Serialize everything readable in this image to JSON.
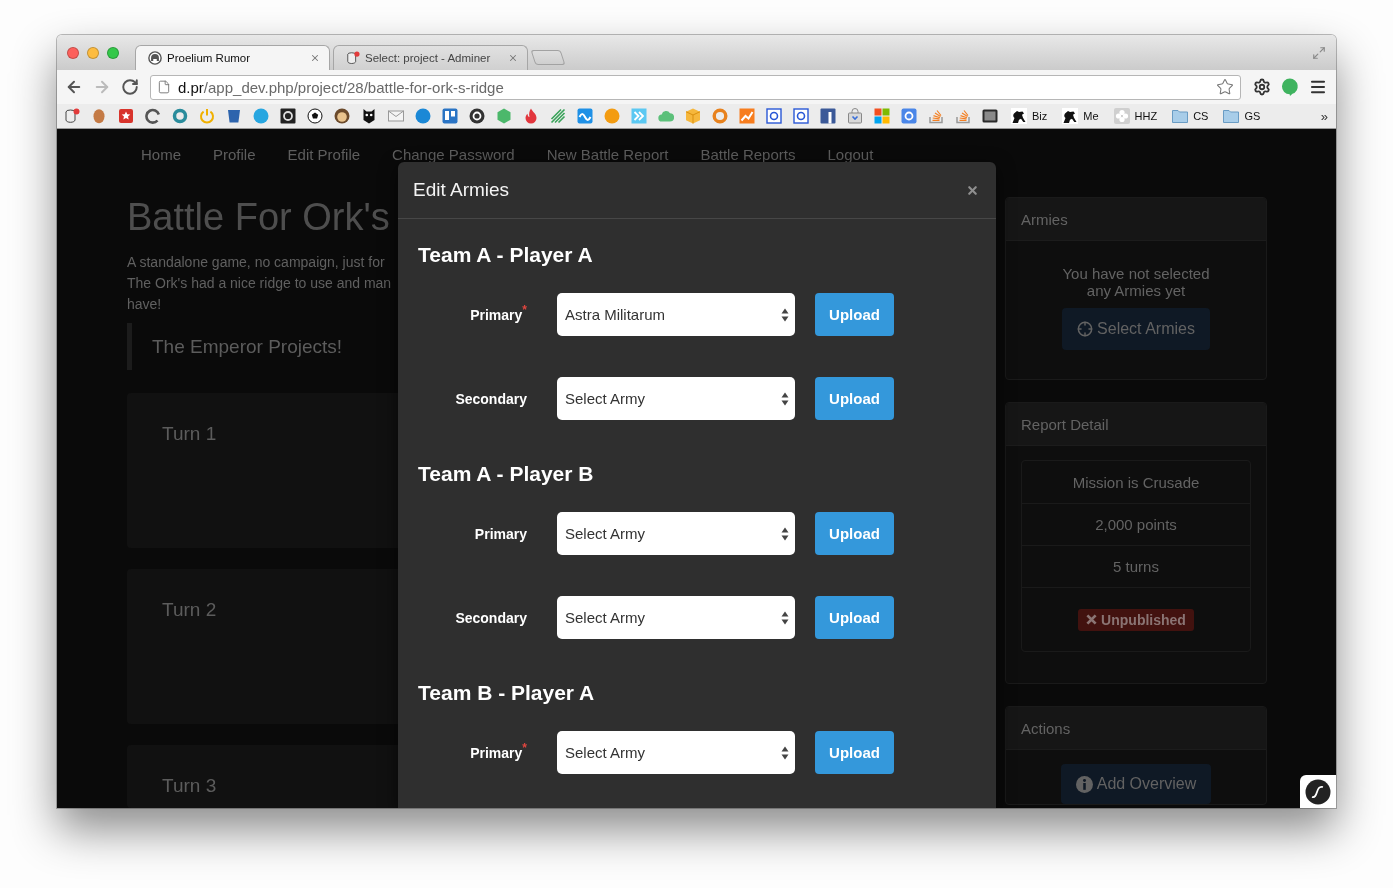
{
  "browser": {
    "tabs": [
      {
        "title": "Proelium Rumor",
        "selected": true
      },
      {
        "title": "Select: project - Adminer",
        "selected": false
      }
    ],
    "back_disabled": false,
    "forward_disabled": true,
    "address": {
      "host": "d.pr",
      "path": "/app_dev.php/project/28/battle-for-ork-s-ridge"
    },
    "starred": false,
    "bookmarks": [
      {
        "kind": "site",
        "label": "Biz"
      },
      {
        "kind": "site",
        "label": "Me"
      },
      {
        "kind": "site",
        "label": "HHZ"
      },
      {
        "kind": "folder",
        "label": "CS"
      },
      {
        "kind": "folder",
        "label": "GS"
      }
    ],
    "bookmarks_overflow": "»"
  },
  "nav": [
    "Home",
    "Profile",
    "Edit Profile",
    "Change Password",
    "New Battle Report",
    "Battle Reports",
    "Logout"
  ],
  "report": {
    "title": "Battle For Ork's",
    "description_lines": [
      "A standalone game, no campaign, just for",
      "The Ork's had a nice ridge to use and man",
      "have!"
    ],
    "quote": "The Emperor Projects!",
    "turns": [
      "Turn 1",
      "Turn 2",
      "Turn 3"
    ]
  },
  "sidebar": {
    "armies": {
      "title": "Armies",
      "message_lines": [
        "You have not selected",
        "any Armies yet"
      ],
      "button": "Select Armies"
    },
    "report_detail": {
      "title": "Report Detail",
      "items": [
        "Mission is Crusade",
        "2,000 points",
        "5 turns"
      ],
      "status": {
        "label": "Unpublished",
        "published": false
      }
    },
    "actions": {
      "title": "Actions",
      "button": "Add Overview"
    }
  },
  "modal": {
    "title": "Edit Armies",
    "sections": [
      {
        "title": "Team A - Player A",
        "rows": [
          {
            "label": "Primary$^{*}$",
            "value": "Astra Militarum",
            "button": "Upload"
          },
          {
            "label": "Secondary",
            "value": "Select Army",
            "button": "Upload"
          }
        ]
      },
      {
        "title": "Team A - Player B",
        "rows": [
          {
            "label": "Primary",
            "value": "Select Army",
            "button": "Upload"
          },
          {
            "label": "Secondary",
            "value": "Select Army",
            "button": "Upload"
          }
        ]
      },
      {
        "title": "Team B - Player A",
        "rows": [
          {
            "label": "Primary$^{*}$",
            "value": "Select Army",
            "button": "Upload"
          }
        ]
      }
    ]
  }
}
